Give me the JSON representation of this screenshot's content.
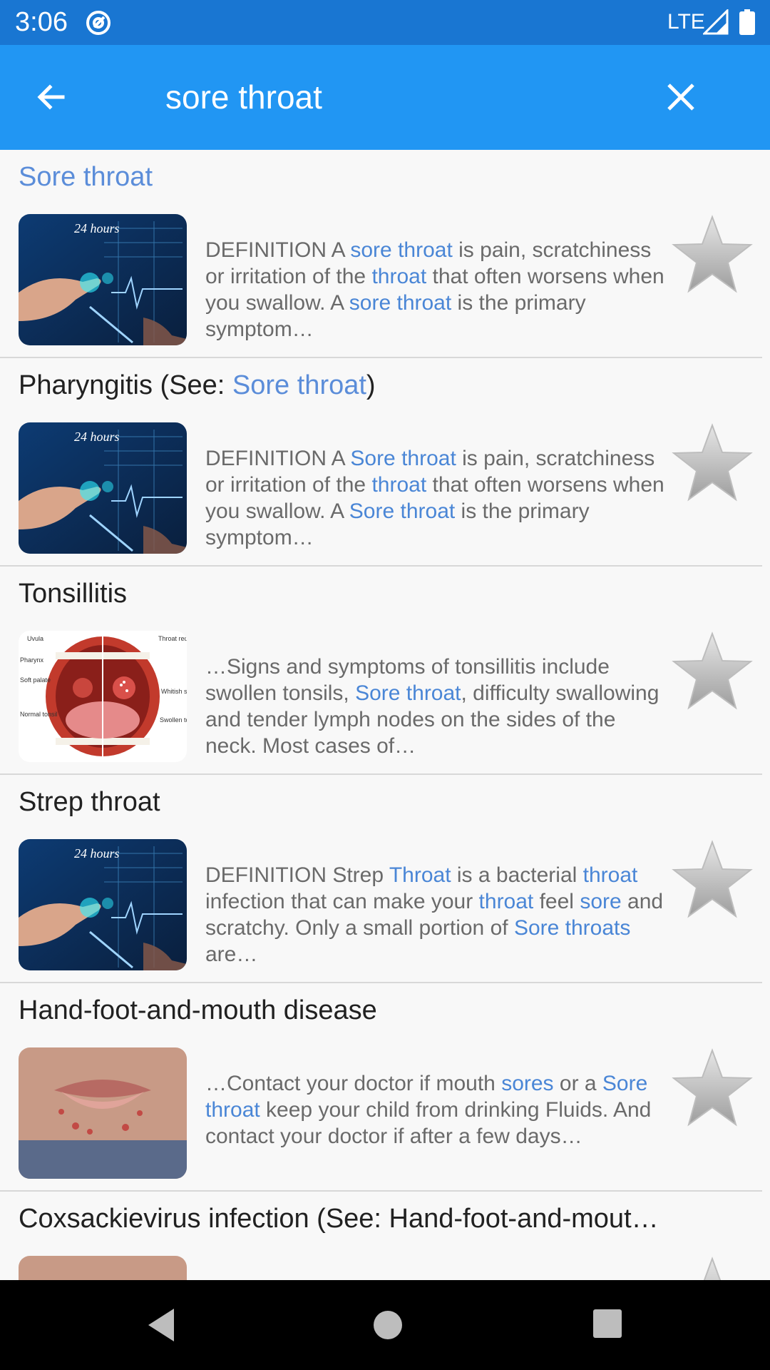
{
  "status_bar": {
    "time": "3:06",
    "network": "LTE"
  },
  "app_bar": {
    "query": "sore throat",
    "back_icon": "arrow-back-icon",
    "close_icon": "close-icon"
  },
  "results": [
    {
      "title": "Sore throat",
      "title_parts": [
        {
          "t": "Sore throat",
          "h": true
        }
      ],
      "thumbnail": "medical-technology-image",
      "snippet": [
        {
          "t": "DEFINITION A "
        },
        {
          "t": "sore throat",
          "h": true
        },
        {
          "t": " is pain, scratchiness or irritation of the "
        },
        {
          "t": "throat",
          "h": true
        },
        {
          "t": " that often worsens when you swallow. A "
        },
        {
          "t": "sore throat",
          "h": true
        },
        {
          "t": " is the primary symptom…"
        }
      ]
    },
    {
      "title": "Pharyngitis (See: Sore throat)",
      "title_parts": [
        {
          "t": "Pharyngitis (See: "
        },
        {
          "t": "Sore throat",
          "h": true
        },
        {
          "t": ")"
        }
      ],
      "thumbnail": "medical-technology-image",
      "snippet": [
        {
          "t": "DEFINITION A "
        },
        {
          "t": "Sore throat",
          "h": true
        },
        {
          "t": " is pain, scratchiness or irritation of the "
        },
        {
          "t": "throat",
          "h": true
        },
        {
          "t": " that often worsens when you swallow. A "
        },
        {
          "t": "Sore throat",
          "h": true
        },
        {
          "t": " is the primary symptom…"
        }
      ]
    },
    {
      "title": "Tonsillitis",
      "title_parts": [
        {
          "t": "Tonsillitis"
        }
      ],
      "thumbnail": "tonsillitis-diagram-image",
      "thumbnail_labels": [
        "Uvula",
        "Pharynx",
        "Soft palate",
        "Normal tonsil",
        "Throat redness",
        "Whitish spots",
        "Swollen tonsil"
      ],
      "snippet": [
        {
          "t": "…Signs and symptoms of tonsillitis include swollen tonsils, "
        },
        {
          "t": "Sore throat",
          "h": true
        },
        {
          "t": ", difficulty swallowing and tender lymph nodes on the sides of the neck. Most cases of…"
        }
      ]
    },
    {
      "title": "Strep throat",
      "title_parts": [
        {
          "t": "Strep throat"
        }
      ],
      "thumbnail": "medical-technology-image",
      "snippet": [
        {
          "t": "DEFINITION Strep "
        },
        {
          "t": "Throat",
          "h": true
        },
        {
          "t": " is a bacterial "
        },
        {
          "t": "throat",
          "h": true
        },
        {
          "t": " infection that can make your "
        },
        {
          "t": "throat",
          "h": true
        },
        {
          "t": " feel "
        },
        {
          "t": "sore",
          "h": true
        },
        {
          "t": " and scratchy. Only a small portion of "
        },
        {
          "t": "Sore throats",
          "h": true
        },
        {
          "t": " are…"
        }
      ]
    },
    {
      "title": "Hand-foot-and-mouth disease",
      "title_parts": [
        {
          "t": "Hand-foot-and-mouth disease"
        }
      ],
      "thumbnail": "child-mouth-rash-image",
      "snippet": [
        {
          "t": "…Contact your doctor if mouth "
        },
        {
          "t": "sores",
          "h": true
        },
        {
          "t": " or a "
        },
        {
          "t": "Sore throat",
          "h": true
        },
        {
          "t": " keep your child from drinking Fluids. And contact your doctor if after a few days…"
        }
      ]
    },
    {
      "title": "Coxsackievirus infection (See: Hand-foot-and-mout…",
      "title_parts": [
        {
          "t": "Coxsackievirus infection (See: Hand-foot-and-mout…"
        }
      ],
      "thumbnail": "child-mouth-rash-image",
      "snippet": []
    }
  ],
  "icons": {
    "favorite": "star-icon",
    "nav_back": "nav-back-icon",
    "nav_home": "nav-home-icon",
    "nav_recent": "nav-recent-icon"
  },
  "colors": {
    "status_bar": "#1976d2",
    "app_bar": "#2196f3",
    "highlight": "#4a86d6",
    "background": "#f8f8f8"
  }
}
